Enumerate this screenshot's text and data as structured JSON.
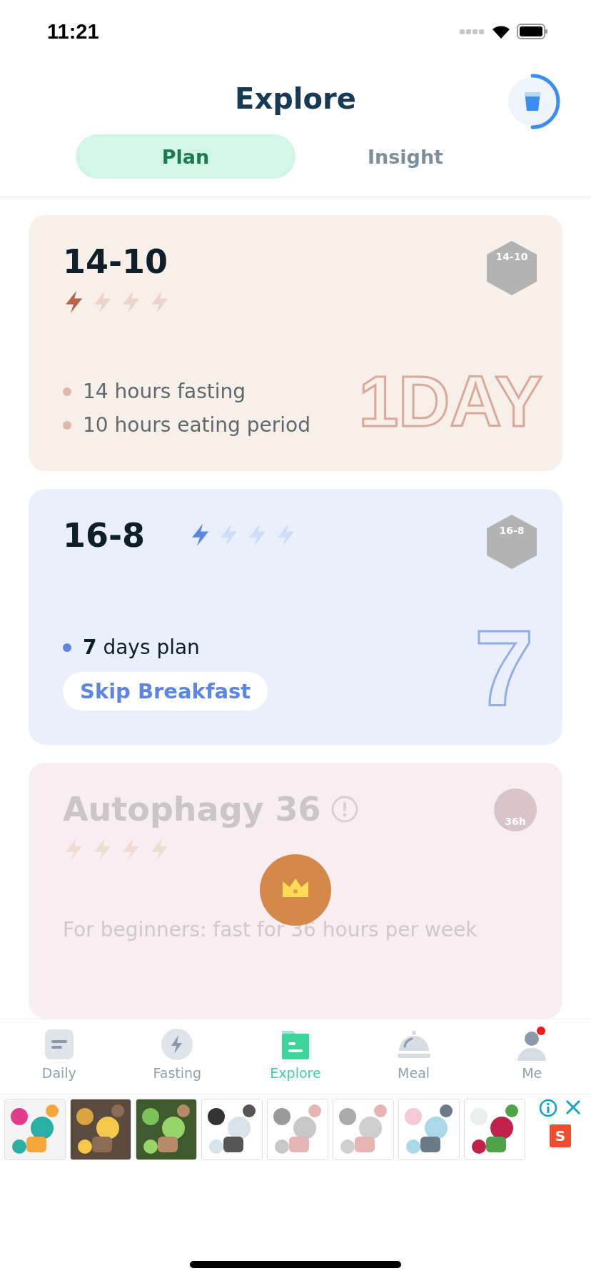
{
  "status_bar": {
    "time": "11:21"
  },
  "header": {
    "title": "Explore",
    "water": {
      "level": 0.5
    }
  },
  "tabs": [
    {
      "label": "Plan",
      "selected": true
    },
    {
      "label": "Insight",
      "selected": false
    }
  ],
  "plans": [
    {
      "kind": "bullets",
      "title": "14-10",
      "stars": 1,
      "badge": "14-10",
      "bullets": [
        "14 hours fasting",
        "10 hours eating period"
      ],
      "watermark": "1DAY",
      "locked": false
    },
    {
      "kind": "plan",
      "title": "16-8",
      "stars": 1,
      "badge": "16-8",
      "bullets": [
        "**7** days plan"
      ],
      "tag": "Skip Breakfast",
      "watermark": "7",
      "locked": false
    },
    {
      "kind": "locked",
      "title": "Autophagy 36",
      "badge": "36h",
      "description": "For beginners: fast for 36 hours per week",
      "locked": true
    }
  ],
  "tab_bar": [
    {
      "label": "Daily",
      "selected": false,
      "notification": false
    },
    {
      "label": "Fasting",
      "selected": false,
      "notification": false
    },
    {
      "label": "Explore",
      "selected": true,
      "notification": false
    },
    {
      "label": "Meal",
      "selected": false,
      "notification": false
    },
    {
      "label": "Me",
      "selected": false,
      "notification": true
    }
  ],
  "ad": {
    "logo": "S"
  }
}
